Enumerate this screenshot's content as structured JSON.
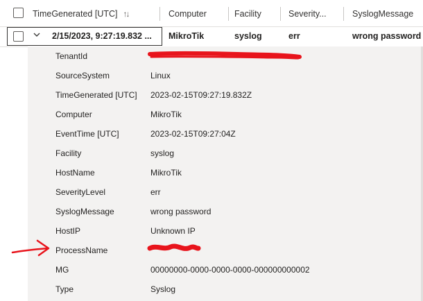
{
  "header": {
    "columns": [
      {
        "label": "TimeGenerated [UTC]"
      },
      {
        "label": "Computer"
      },
      {
        "label": "Facility"
      },
      {
        "label": "Severity..."
      },
      {
        "label": "SyslogMessage"
      }
    ],
    "sort_glyph": "↑↓"
  },
  "row": {
    "time": "2/15/2023, 9:27:19.832 ...",
    "computer": "MikroTik",
    "facility": "syslog",
    "severity": "err",
    "message": "wrong password"
  },
  "details": [
    {
      "key": "TenantId",
      "value": "",
      "redacted": true
    },
    {
      "key": "SourceSystem",
      "value": "Linux"
    },
    {
      "key": "TimeGenerated [UTC]",
      "value": "2023-02-15T09:27:19.832Z"
    },
    {
      "key": "Computer",
      "value": "MikroTik"
    },
    {
      "key": "EventTime [UTC]",
      "value": "2023-02-15T09:27:04Z"
    },
    {
      "key": "Facility",
      "value": "syslog"
    },
    {
      "key": "HostName",
      "value": "MikroTik"
    },
    {
      "key": "SeverityLevel",
      "value": "err"
    },
    {
      "key": "SyslogMessage",
      "value": "wrong password"
    },
    {
      "key": "HostIP",
      "value": "Unknown IP"
    },
    {
      "key": "ProcessName",
      "value": "",
      "redacted": true
    },
    {
      "key": "MG",
      "value": "00000000-0000-0000-0000-000000000002"
    },
    {
      "key": "Type",
      "value": "Syslog"
    }
  ],
  "colors": {
    "details_bg": "#f3f2f1",
    "annotation_red": "#e8141c",
    "border": "#e1dfdd"
  }
}
